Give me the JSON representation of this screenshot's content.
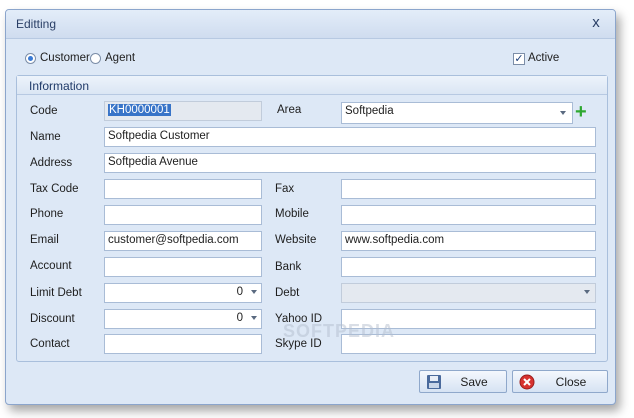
{
  "window": {
    "title": "Editting",
    "close_glyph": "x"
  },
  "type_options": [
    {
      "label": "Customer",
      "selected": true
    },
    {
      "label": "Agent",
      "selected": false
    }
  ],
  "active": {
    "label": "Active",
    "checked": true
  },
  "group_title": "Information",
  "fields": {
    "code": {
      "label": "Code",
      "value": "KH0000001"
    },
    "area": {
      "label": "Area",
      "value": "Softpedia"
    },
    "name": {
      "label": "Name",
      "value": "Softpedia Customer"
    },
    "address": {
      "label": "Address",
      "value": "Softpedia Avenue"
    },
    "tax_code": {
      "label": "Tax Code",
      "value": ""
    },
    "fax": {
      "label": "Fax",
      "value": ""
    },
    "phone": {
      "label": "Phone",
      "value": ""
    },
    "mobile": {
      "label": "Mobile",
      "value": ""
    },
    "email": {
      "label": "Email",
      "value": "customer@softpedia.com"
    },
    "website": {
      "label": "Website",
      "value": "www.softpedia.com"
    },
    "account": {
      "label": "Account",
      "value": ""
    },
    "bank": {
      "label": "Bank",
      "value": ""
    },
    "limit_debt": {
      "label": "Limit Debt",
      "value": "0"
    },
    "debt": {
      "label": "Debt",
      "value": ""
    },
    "discount": {
      "label": "Discount",
      "value": "0"
    },
    "yahoo_id": {
      "label": "Yahoo ID",
      "value": ""
    },
    "contact": {
      "label": "Contact",
      "value": ""
    },
    "skype_id": {
      "label": "Skype ID",
      "value": ""
    }
  },
  "buttons": {
    "save": "Save",
    "close": "Close"
  },
  "watermark": "SOFTPEDIA",
  "colors": {
    "accent": "#3874c8",
    "add": "#2ea830",
    "window_bg": "#dde8f6"
  },
  "icons": {
    "save": "floppy-disk-icon",
    "close": "close-circle-icon",
    "add": "plus-icon"
  }
}
